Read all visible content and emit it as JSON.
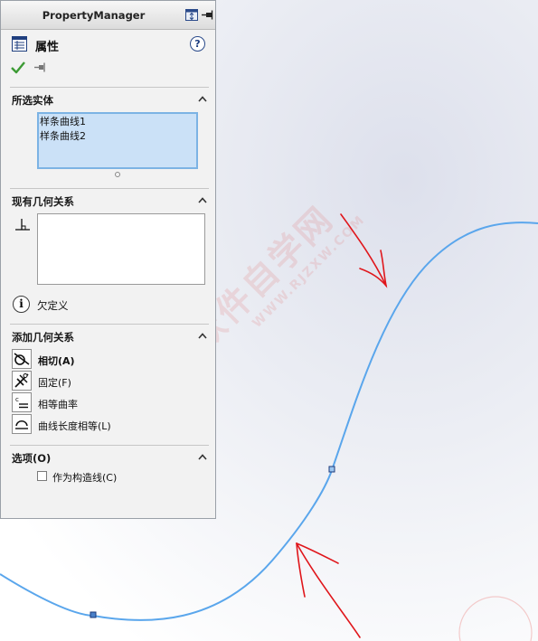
{
  "panel": {
    "title": "PropertyManager",
    "header": {
      "title": "属性",
      "help_symbol": "?"
    }
  },
  "sections": {
    "selected_entities": {
      "title": "所选实体",
      "items": [
        "样条曲线1",
        "样条曲线2"
      ]
    },
    "existing_relations": {
      "title": "现有几何关系",
      "items": [],
      "status_icon": "i",
      "status": "欠定义"
    },
    "add_relations": {
      "title": "添加几何关系",
      "items": [
        {
          "label": "相切(A)",
          "icon": "tangent-icon"
        },
        {
          "label": "固定(F)",
          "icon": "fix-icon"
        },
        {
          "label": "相等曲率",
          "icon": "equal-curvature-icon"
        },
        {
          "label": "曲线长度相等(L)",
          "icon": "equal-curve-length-icon"
        }
      ]
    },
    "options": {
      "title": "选项(O)",
      "construction_checkbox": {
        "label": "作为构造线(C)",
        "checked": false
      }
    }
  },
  "watermark": {
    "text": "软件自学网",
    "url": "WWW.RJZXW.COM"
  },
  "colors": {
    "curve": "#5aa6ec",
    "annotation": "#e0161b",
    "selection_fill": "#cbe1f7",
    "ok_check": "#3d9b35"
  }
}
